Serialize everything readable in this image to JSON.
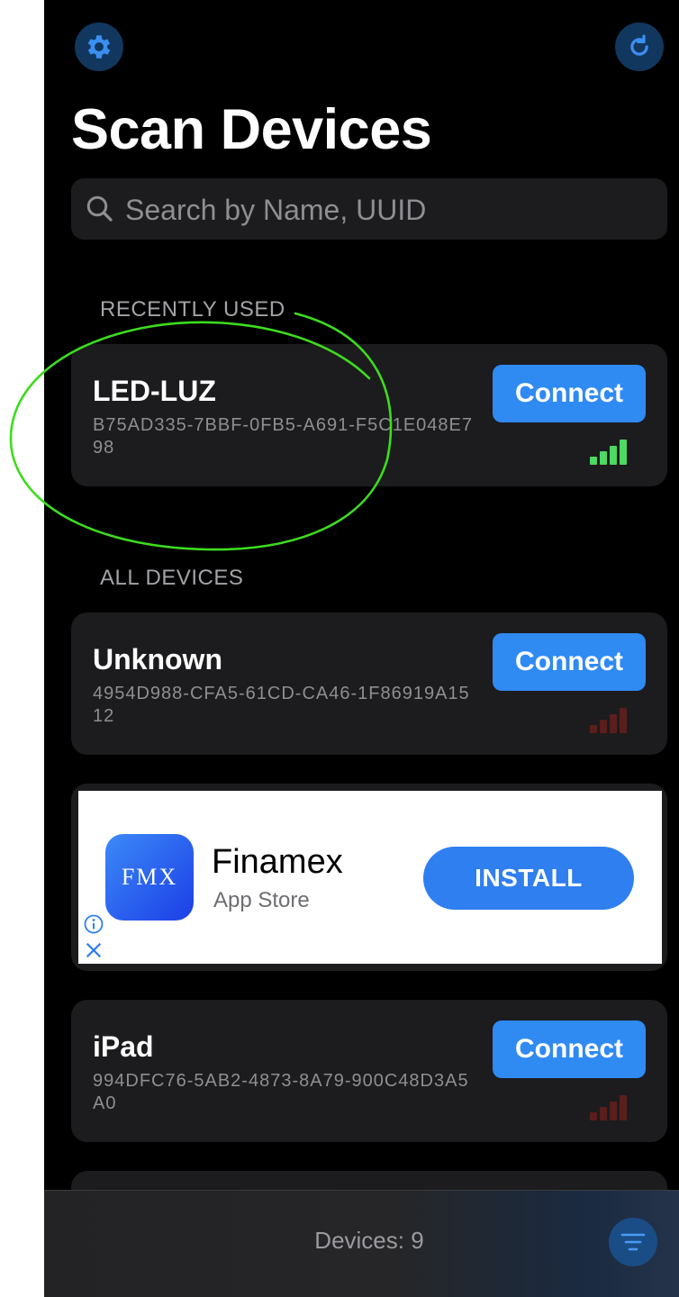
{
  "header": {
    "title": "Scan Devices",
    "settings_icon": "gear-icon",
    "refresh_icon": "refresh-icon"
  },
  "search": {
    "placeholder": "Search by Name, UUID"
  },
  "sections": {
    "recently_used": "RECENTLY USED",
    "all_devices": "ALL DEVICES"
  },
  "recent_devices": [
    {
      "name": "LED-LUZ",
      "uuid": "B75AD335-7BBF-0FB5-A691-F5C1E048E798",
      "connect_label": "Connect",
      "signal_bars": 4,
      "signal_color": "#4cd964"
    }
  ],
  "devices": [
    {
      "name": "Unknown",
      "uuid": "4954D988-CFA5-61CD-CA46-1F86919A1512",
      "connect_label": "Connect",
      "signal_bars": 4,
      "signal_color": "#5a1e1c"
    },
    {
      "name": "iPad",
      "uuid": "994DFC76-5AB2-4873-8A79-900C48D3A5A0",
      "connect_label": "Connect",
      "signal_bars": 4,
      "signal_color": "#5a1e1c"
    }
  ],
  "ad": {
    "logo_text": "FMX",
    "title": "Finamex",
    "subtitle": "App Store",
    "install_label": "INSTALL",
    "info_icon": "info-icon",
    "close_icon": "close-icon"
  },
  "footer": {
    "device_count": "Devices: 9",
    "filter_icon": "filter-icon"
  },
  "colors": {
    "accent": "#2f8af2",
    "background": "#000000",
    "card": "#1c1c1e",
    "signal_strong": "#4cd964",
    "signal_weak": "#5a1e1c",
    "annotation": "#3ddc1e"
  }
}
